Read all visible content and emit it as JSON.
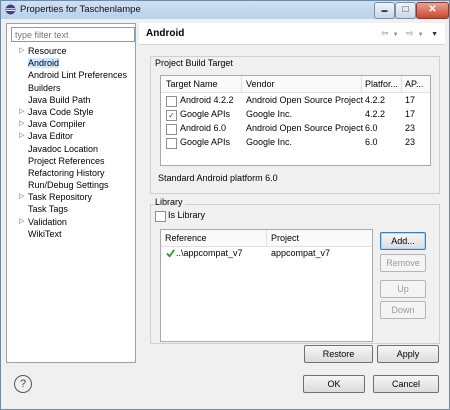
{
  "window": {
    "title": "Properties for Taschenlampe"
  },
  "filter": {
    "placeholder": "type filter text"
  },
  "tree": [
    {
      "label": "Resource",
      "expandable": true
    },
    {
      "label": "Android",
      "expandable": false,
      "selected": true
    },
    {
      "label": "Android Lint Preferences",
      "expandable": false
    },
    {
      "label": "Builders",
      "expandable": false
    },
    {
      "label": "Java Build Path",
      "expandable": false
    },
    {
      "label": "Java Code Style",
      "expandable": true
    },
    {
      "label": "Java Compiler",
      "expandable": true
    },
    {
      "label": "Java Editor",
      "expandable": true
    },
    {
      "label": "Javadoc Location",
      "expandable": false
    },
    {
      "label": "Project References",
      "expandable": false
    },
    {
      "label": "Refactoring History",
      "expandable": false
    },
    {
      "label": "Run/Debug Settings",
      "expandable": false
    },
    {
      "label": "Task Repository",
      "expandable": true
    },
    {
      "label": "Task Tags",
      "expandable": false
    },
    {
      "label": "Validation",
      "expandable": true
    },
    {
      "label": "WikiText",
      "expandable": false
    }
  ],
  "header": {
    "title": "Android"
  },
  "build_target": {
    "group_label": "Project Build Target",
    "columns": [
      "Target Name",
      "Vendor",
      "Platfor...",
      "AP..."
    ],
    "rows": [
      {
        "checked": false,
        "name": "Android 4.2.2",
        "vendor": "Android Open Source Project",
        "platform": "4.2.2",
        "api": "17"
      },
      {
        "checked": true,
        "name": "Google APIs",
        "vendor": "Google Inc.",
        "platform": "4.2.2",
        "api": "17"
      },
      {
        "checked": false,
        "name": "Android 6.0",
        "vendor": "Android Open Source Project",
        "platform": "6.0",
        "api": "23"
      },
      {
        "checked": false,
        "name": "Google APIs",
        "vendor": "Google Inc.",
        "platform": "6.0",
        "api": "23"
      }
    ],
    "status": "Standard Android platform 6.0"
  },
  "library": {
    "group_label": "Library",
    "is_library_label": "Is Library",
    "is_library_checked": false,
    "columns": [
      "Reference",
      "Project"
    ],
    "rows": [
      {
        "reference": "..\\appcompat_v7",
        "project": "appcompat_v7"
      }
    ],
    "buttons": {
      "add": "Add...",
      "remove": "Remove",
      "up": "Up",
      "down": "Down"
    }
  },
  "buttons": {
    "restore_defaults": "Restore Defaults",
    "apply": "Apply",
    "ok": "OK",
    "cancel": "Cancel"
  },
  "icons": {
    "help": "?",
    "close": "✕",
    "minimize": "▬",
    "maximize": "□"
  },
  "colors": {
    "check": "#2a9a2a",
    "selection": "#cde8ff"
  }
}
